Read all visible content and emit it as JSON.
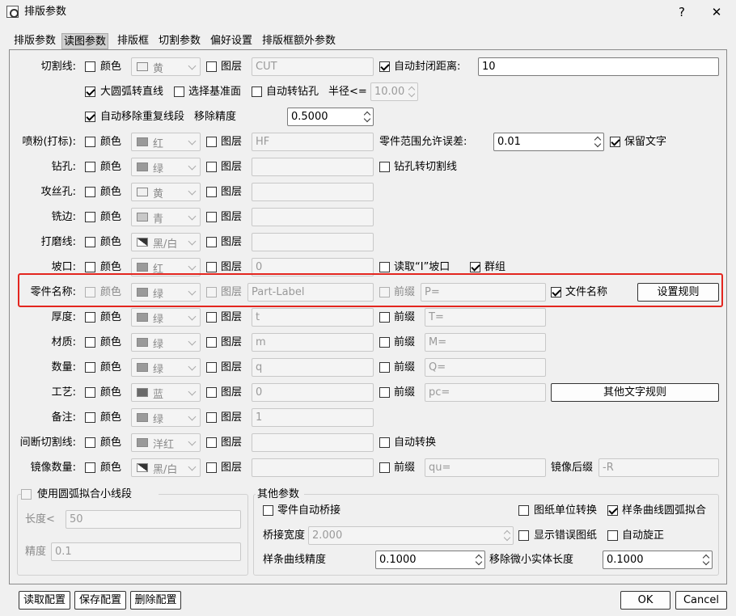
{
  "window": {
    "title": "排版参数",
    "help": "?",
    "close": "✕"
  },
  "tabs": [
    "排版参数",
    "读图参数",
    "排版框",
    "切割参数",
    "偏好设置",
    "排版框额外参数"
  ],
  "common": {
    "color": "颜色",
    "layer": "图层",
    "prefix": "前缀"
  },
  "cut": {
    "label": "切割线:",
    "color_value": "黄",
    "layer_value": "CUT",
    "auto_close": "自动封闭距离:",
    "auto_close_value": "10",
    "arc_to_line": "大圆弧转直线",
    "select_base": "选择基准面",
    "auto_drill": "自动转钻孔",
    "radius_label": "半径<=",
    "radius_value": "10.00",
    "auto_remove": "自动移除重复线段",
    "remove_precision": "移除精度",
    "remove_precision_value": "0.5000"
  },
  "powder": {
    "label": "喷粉(打标):",
    "color_value": "红",
    "layer_value": "HF",
    "tol_label": "零件范围允许误差:",
    "tol_value": "0.01",
    "keep_text": "保留文字"
  },
  "drill": {
    "label": "钻孔:",
    "color_value": "绿",
    "drill_to_cut": "钻孔转切割线"
  },
  "tap": {
    "label": "攻丝孔:",
    "color_value": "黄"
  },
  "mill": {
    "label": "铣边:",
    "color_value": "青"
  },
  "grind": {
    "label": "打磨线:",
    "color_value": "黑/白"
  },
  "bevel": {
    "label": "坡口:",
    "color_value": "红",
    "layer_value": "0",
    "read_bevel": "读取“I”坡口",
    "group": "群组"
  },
  "partname": {
    "label": "零件名称:",
    "color_value": "绿",
    "layer_value": "Part-Label",
    "prefix_value": "P=",
    "file_name": "文件名称",
    "rule_btn": "设置规则"
  },
  "thickness": {
    "label": "厚度:",
    "color_value": "绿",
    "layer_value": "t",
    "prefix_value": "T="
  },
  "material": {
    "label": "材质:",
    "color_value": "绿",
    "layer_value": "m",
    "prefix_value": "M="
  },
  "quantity": {
    "label": "数量:",
    "color_value": "绿",
    "layer_value": "q",
    "prefix_value": "Q="
  },
  "process": {
    "label": "工艺:",
    "color_value": "蓝",
    "layer_value": "0",
    "prefix_value": "pc=",
    "other_btn": "其他文字规则"
  },
  "note": {
    "label": "备注:",
    "color_value": "绿",
    "layer_value": "1"
  },
  "intermittent": {
    "label": "间断切割线:",
    "color_value": "洋红",
    "auto_convert": "自动转换"
  },
  "mirror": {
    "label": "镜像数量:",
    "color_value": "黑/白",
    "prefix_value": "qu=",
    "suffix_label": "镜像后缀",
    "suffix_value": "-R"
  },
  "arcfit": {
    "title": "使用圆弧拟合小线段",
    "length_label": "长度<",
    "length_value": "50",
    "precision_label": "精度",
    "precision_value": "0.1"
  },
  "other": {
    "title": "其他参数",
    "auto_bridge": "零件自动桥接",
    "unit_convert": "图纸单位转换",
    "spline_fit": "样条曲线圆弧拟合",
    "bridge_width": "桥接宽度",
    "bridge_value": "2.000",
    "show_error": "显示错误图纸",
    "auto_rotate": "自动旋正",
    "spline_precision": "样条曲线精度",
    "spline_value": "0.1000",
    "remove_small": "移除微小实体长度",
    "remove_small_value": "0.1000"
  },
  "footer": {
    "read": "读取配置",
    "save": "保存配置",
    "delete": "删除配置",
    "ok": "OK",
    "cancel": "Cancel"
  }
}
